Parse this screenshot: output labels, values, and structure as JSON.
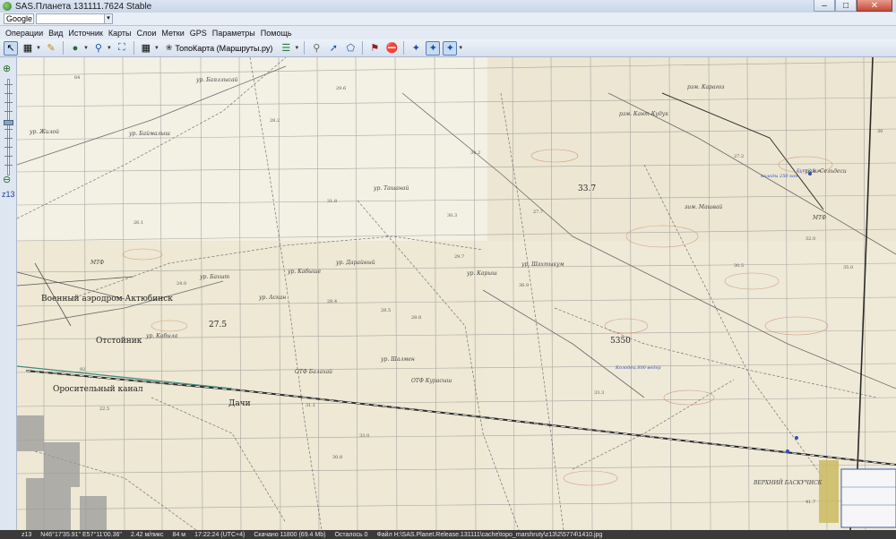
{
  "window": {
    "title": "SAS.Планета 131111.7624 Stable"
  },
  "search": {
    "engine": "Google",
    "placeholder": ""
  },
  "menu": {
    "items": [
      "Операции",
      "Вид",
      "Источник",
      "Карты",
      "Слои",
      "Метки",
      "GPS",
      "Параметры",
      "Помощь"
    ]
  },
  "toolbar": {
    "map_source_label": "ТопоКарта (Маршруты.ру)"
  },
  "zoom": {
    "level_label": "z13"
  },
  "map": {
    "labels_big": [
      {
        "text": "Военный аэродром Актюбинск",
        "cls": "big"
      },
      {
        "text": "Отстойник",
        "cls": "big"
      },
      {
        "text": "Оросительный канал",
        "cls": "big"
      },
      {
        "text": "Дачи",
        "cls": "big"
      },
      {
        "text": "ВЕРХНИЙ БАСКУЧИСК",
        "cls": "small"
      },
      {
        "text": "27.5",
        "cls": "big"
      },
      {
        "text": "33.7",
        "cls": "big"
      },
      {
        "text": "5350",
        "cls": "big"
      }
    ],
    "labels_small": [
      "ур. Жилой",
      "ур. Баймалыш",
      "ур. Ташанай",
      "ур. Кабыше",
      "ур. Дарайный",
      "ур. Баяллысай",
      "ур. Кабыла",
      "ур. Аскан",
      "ур. Бахыт",
      "ур. Шалмен",
      "рзм. Кант-Кудук",
      "рзм. Карагоз",
      "рзм. Сельдеси",
      "ур. Карыш",
      "ур. Шахтыкум",
      "МТФ",
      "ОТФ Курасыш",
      "ОТФ Балахай",
      "зим. Машвай",
      "МТФ"
    ],
    "labels_num": [
      "64",
      "92",
      "30",
      "29.6",
      "26.1",
      "28.2",
      "31.8",
      "34.2",
      "30.5",
      "33.3",
      "41.7",
      "28.5",
      "36.9",
      "28.4",
      "28.8",
      "24.0",
      "27.2",
      "32.0",
      "30.3",
      "29.7",
      "31.1",
      "33.0",
      "22.5",
      "27.7",
      "30.8",
      "35.0"
    ],
    "labels_blue": [
      "Бут 2.5 м",
      "колоды 250 кон",
      "Колодец 800 ведер"
    ]
  },
  "status": {
    "items": [
      "z13",
      "N46°17'35.91\" E57°11'00.36\"",
      "2.42 м/пикс",
      "84 м",
      "17:22:24 (UTC+4)",
      "Скачано 11800 (69.4 Mb)",
      "Осталось 0",
      "Файл H:\\SAS.Planet.Release.131111\\cache\\topo_marshruty\\z13\\2\\5774\\1410.jpg"
    ]
  },
  "colors": {
    "map_paper": "#efeadb",
    "grid": "#8a8a8a",
    "rail": "#2a2a2a",
    "canal": "#3d8a7a",
    "contour": "#c98a6a"
  }
}
